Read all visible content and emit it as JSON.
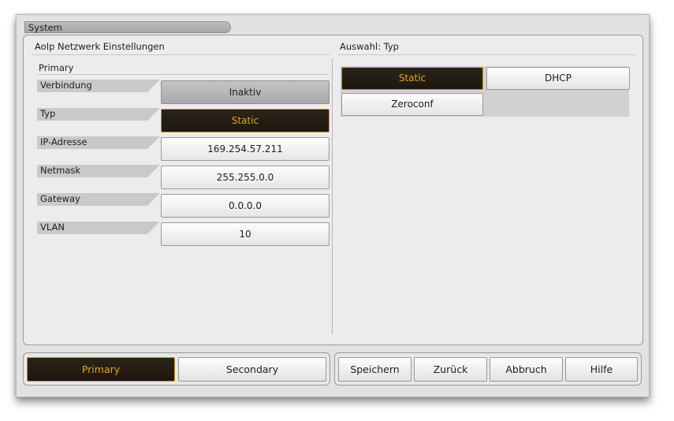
{
  "window": {
    "title": "System"
  },
  "left_panel": {
    "title": "AoIp Netzwerk Einstellungen",
    "subsection": "Primary",
    "rows": [
      {
        "label": "Verbindung",
        "value": "Inaktiv"
      },
      {
        "label": "Typ",
        "value": "Static"
      },
      {
        "label": "IP-Adresse",
        "value": "169.254.57.211"
      },
      {
        "label": "Netmask",
        "value": "255.255.0.0"
      },
      {
        "label": "Gateway",
        "value": "0.0.0.0"
      },
      {
        "label": "VLAN",
        "value": "10"
      }
    ]
  },
  "right_panel": {
    "title": "Auswahl: Typ",
    "options": [
      {
        "label": "Static",
        "selected": true
      },
      {
        "label": "DHCP",
        "selected": false
      },
      {
        "label": "Zeroconf",
        "selected": false
      }
    ]
  },
  "bottom_bar": {
    "tabs": [
      {
        "label": "Primary",
        "selected": true
      },
      {
        "label": "Secondary",
        "selected": false
      }
    ],
    "actions": {
      "save": "Speichern",
      "back": "Zurück",
      "cancel": "Abbruch",
      "help": "Hilfe"
    }
  },
  "colors": {
    "accent": "#e0a52d",
    "active_bg": "#231d14",
    "panel_bg": "#ececec",
    "frame_bg": "#e2e2e2"
  }
}
